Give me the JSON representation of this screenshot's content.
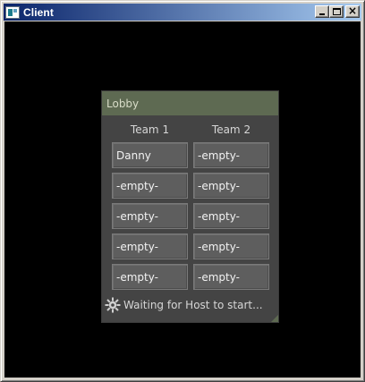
{
  "window": {
    "title": "Client",
    "buttons": {
      "minimize": "minimize",
      "maximize": "maximize",
      "close": "×"
    }
  },
  "lobby": {
    "title": "Lobby",
    "teams": [
      {
        "name": "Team 1",
        "slots": [
          "Danny",
          "-empty-",
          "-empty-",
          "-empty-",
          "-empty-"
        ]
      },
      {
        "name": "Team 2",
        "slots": [
          "-empty-",
          "-empty-",
          "-empty-",
          "-empty-",
          "-empty-"
        ]
      }
    ],
    "status_text": "Waiting for Host to start...",
    "status_icon": "spinner-gear-icon",
    "colors": {
      "header": "#5e6a52",
      "panel": "#444444",
      "slot": "#5e5e5e"
    }
  }
}
